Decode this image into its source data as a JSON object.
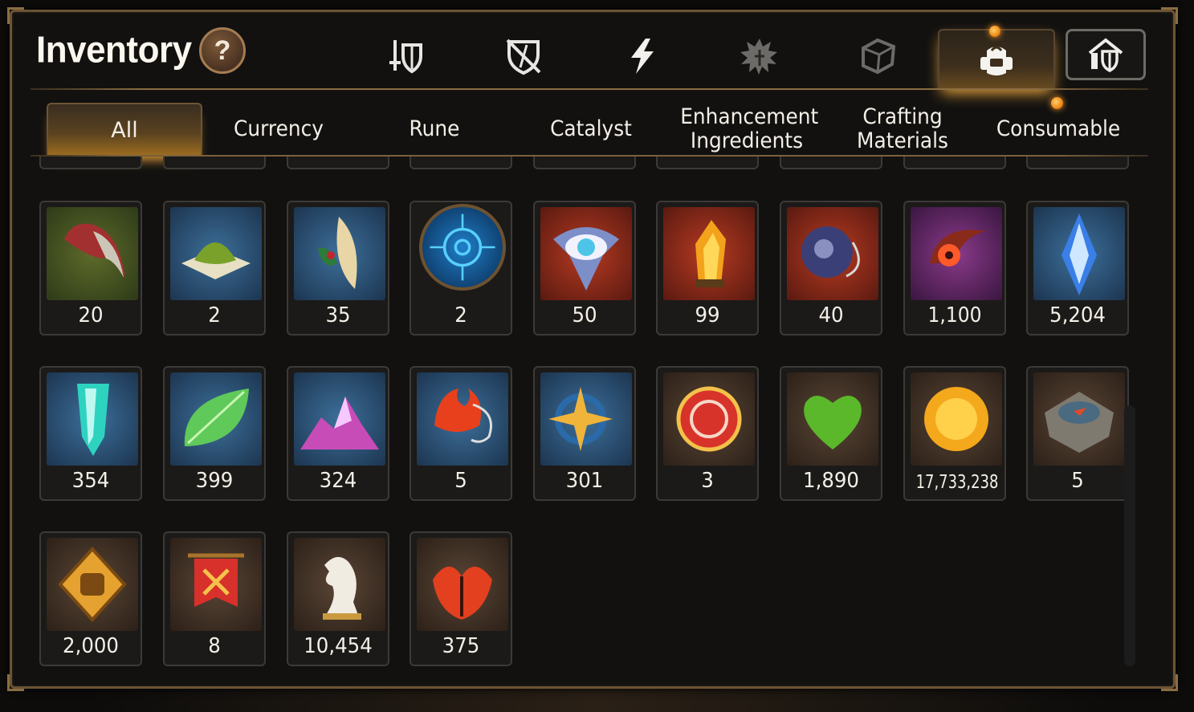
{
  "header": {
    "title": "Inventory",
    "help_label": "?"
  },
  "icon_tabs": [
    {
      "name": "equipment-tab",
      "icon": "sword-shield-icon"
    },
    {
      "name": "artifact-tab",
      "icon": "broken-shield-icon"
    },
    {
      "name": "skill-tab",
      "icon": "lightning-icon"
    },
    {
      "name": "monster-tab",
      "icon": "spiky-creature-icon"
    },
    {
      "name": "misc-tab",
      "icon": "cube-icon"
    },
    {
      "name": "items-tab",
      "icon": "backpack-icon",
      "selected": true
    },
    {
      "name": "storage-tab",
      "icon": "castle-shield-icon"
    }
  ],
  "categories": [
    {
      "label": "All",
      "selected": true
    },
    {
      "label": "Currency"
    },
    {
      "label": "Rune"
    },
    {
      "label": "Catalyst"
    },
    {
      "label": "Enhancement Ingredients"
    },
    {
      "label": "Crafting Materials"
    },
    {
      "label": "Consumable"
    }
  ],
  "items": [
    {
      "icon": "claw-icon",
      "count": "20",
      "bg": "green"
    },
    {
      "icon": "sand-mound-icon",
      "count": "2",
      "bg": "blue"
    },
    {
      "icon": "feather-icon",
      "count": "35",
      "bg": "blue"
    },
    {
      "icon": "rune-disc-icon",
      "count": "2",
      "bg": "round"
    },
    {
      "icon": "eye-gem-icon",
      "count": "50",
      "bg": "red"
    },
    {
      "icon": "flame-crystal-icon",
      "count": "99",
      "bg": "red"
    },
    {
      "icon": "rope-pendant-icon",
      "count": "40",
      "bg": "red"
    },
    {
      "icon": "flower-bracelet-icon",
      "count": "1,100",
      "bg": "purple"
    },
    {
      "icon": "blue-gem-icon",
      "count": "5,204",
      "bg": "blue"
    },
    {
      "icon": "teal-crystal-icon",
      "count": "354",
      "bg": "blue"
    },
    {
      "icon": "leaf-icon",
      "count": "399",
      "bg": "blue"
    },
    {
      "icon": "crystal-pile-icon",
      "count": "324",
      "bg": "blue"
    },
    {
      "icon": "flame-charm-icon",
      "count": "5",
      "bg": "blue"
    },
    {
      "icon": "star-charm-icon",
      "count": "301",
      "bg": "blue"
    },
    {
      "icon": "seal-badge-icon",
      "count": "3",
      "bg": "brown"
    },
    {
      "icon": "heart-icon",
      "count": "1,890",
      "bg": "brown"
    },
    {
      "icon": "gold-coin-icon",
      "count": "17,733,238",
      "bg": "brown"
    },
    {
      "icon": "stone-compass-icon",
      "count": "5",
      "bg": "brown"
    },
    {
      "icon": "fist-emblem-icon",
      "count": "2,000",
      "bg": "brown"
    },
    {
      "icon": "war-banner-icon",
      "count": "8",
      "bg": "brown"
    },
    {
      "icon": "knight-chess-icon",
      "count": "10,454",
      "bg": "brown"
    },
    {
      "icon": "red-leaf-icon",
      "count": "375",
      "bg": "brown"
    }
  ],
  "colors": {
    "accent_gold": "#e8a53c",
    "panel_border": "#6b5434",
    "notification": "#f08a16"
  }
}
